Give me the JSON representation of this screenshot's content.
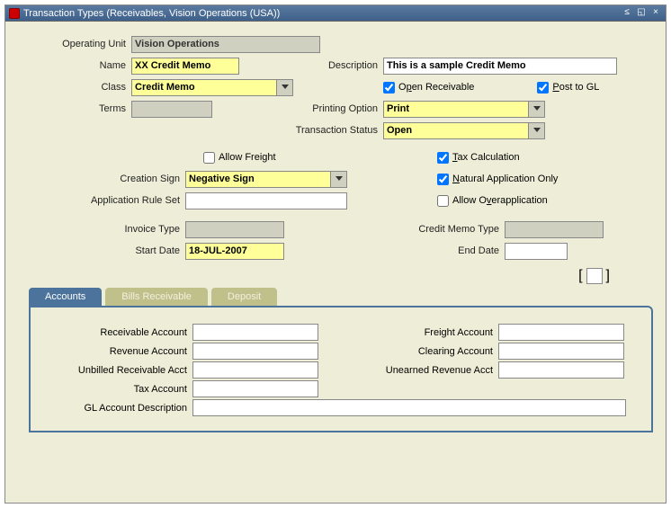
{
  "window": {
    "title": "Transaction Types (Receivables, Vision Operations (USA))"
  },
  "labels": {
    "operating_unit": "Operating Unit",
    "name": "Name",
    "description": "Description",
    "class": "Class",
    "terms": "Terms",
    "printing_option": "Printing Option",
    "transaction_status": "Transaction Status",
    "creation_sign": "Creation Sign",
    "application_rule_set": "Application Rule Set",
    "invoice_type": "Invoice Type",
    "start_date": "Start Date",
    "credit_memo_type": "Credit Memo Type",
    "end_date": "End Date"
  },
  "values": {
    "operating_unit": "Vision Operations",
    "name": "XX Credit Memo",
    "description": "This is a sample Credit Memo",
    "class": "Credit Memo",
    "terms": "",
    "printing_option": "Print",
    "transaction_status": "Open",
    "creation_sign": "Negative Sign",
    "application_rule_set": "",
    "invoice_type": "",
    "start_date": "18-JUL-2007",
    "credit_memo_type": "",
    "end_date": ""
  },
  "checkboxes": {
    "open_receivable": {
      "label_pre": "O",
      "label_u": "p",
      "label_post": "en Receivable",
      "checked": true
    },
    "post_to_gl": {
      "label_pre": "",
      "label_u": "P",
      "label_post": "ost to GL",
      "checked": true
    },
    "allow_freight": {
      "label_pre": "Allow Freight",
      "checked": false
    },
    "tax_calculation": {
      "label_pre": "",
      "label_u": "T",
      "label_post": "ax Calculation",
      "checked": true
    },
    "natural_application": {
      "label_pre": "",
      "label_u": "N",
      "label_post": "atural Application Only",
      "checked": true
    },
    "allow_overapplication": {
      "label_pre": "Allow O",
      "label_u": "v",
      "label_post": "erapplication",
      "checked": false
    }
  },
  "tabs": {
    "accounts": "Accounts",
    "bills_receivable": "Bills Receivable",
    "deposit": "Deposit"
  },
  "accounts": {
    "receivable_account": {
      "label": "Receivable Account",
      "value": ""
    },
    "revenue_account": {
      "label": "Revenue Account",
      "value": ""
    },
    "unbilled_receivable_acct": {
      "label": "Unbilled Receivable Acct",
      "value": ""
    },
    "tax_account": {
      "label": "Tax Account",
      "value": ""
    },
    "freight_account": {
      "label": "Freight Account",
      "value": ""
    },
    "clearing_account": {
      "label": "Clearing Account",
      "value": ""
    },
    "unearned_revenue_acct": {
      "label": "Unearned Revenue Acct",
      "value": ""
    },
    "gl_account_description": {
      "label": "GL Account Description",
      "value": ""
    }
  },
  "brackets": {
    "open": "[",
    "close": "]"
  }
}
